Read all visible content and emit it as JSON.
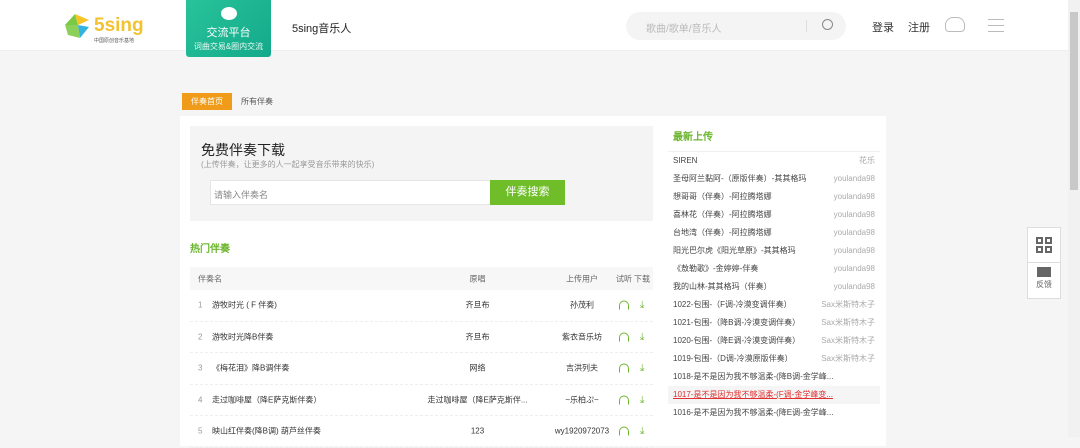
{
  "header": {
    "logo_text": "5sing",
    "logo_sub": "中国原创音乐基地",
    "platform_title": "交流平台",
    "platform_sub": "词曲交易&圈内交流",
    "musician": "5sing音乐人",
    "search_placeholder": "歌曲/歌单/音乐人",
    "login": "登录",
    "register": "注册"
  },
  "tabs": [
    "伴奏首页",
    "所有伴奏"
  ],
  "download": {
    "title": "免费伴奏下载",
    "subtitle": "(上传伴奏，让更多的人一起享受音乐带来的快乐)",
    "input_placeholder": "请输入伴奏名",
    "button": "伴奏搜索"
  },
  "hot": {
    "title": "热门伴奏",
    "headers": {
      "name": "伴奏名",
      "original": "原唱",
      "uploader": "上传用户",
      "listen": "试听",
      "download": "下载"
    },
    "rows": [
      {
        "idx": "1",
        "name": "游牧时光 ( F 伴奏)",
        "original": "齐旦布",
        "uploader": "孙茂利"
      },
      {
        "idx": "2",
        "name": "游牧时光降B伴奏",
        "original": "齐旦布",
        "uploader": "紫衣音乐坊"
      },
      {
        "idx": "3",
        "name": "《梅花泪》降B调伴奏",
        "original": "网络",
        "uploader": "吉洪列夫"
      },
      {
        "idx": "4",
        "name": "走过咖啡屋（降E萨克斯伴奏）",
        "original": "走过咖啡屋（降E萨克斯伴...",
        "uploader": "~乐柏ぷ~"
      },
      {
        "idx": "5",
        "name": "映山红伴奏(降B调) 葫芦丝伴奏",
        "original": "123",
        "uploader": "wy1920972073"
      }
    ]
  },
  "latest": {
    "title": "最新上传",
    "items": [
      {
        "name": "SIREN",
        "user": "花乐"
      },
      {
        "name": "圣母阿兰黏阿-（原版伴奏）-其其格玛",
        "user": "youlanda98"
      },
      {
        "name": "想哥哥（伴奏）-阿拉腾塔娜",
        "user": "youlanda98"
      },
      {
        "name": "喜林花（伴奏）-阿拉腾塔娜",
        "user": "youlanda98"
      },
      {
        "name": "台地湾（伴奏）-阿拉腾塔娜",
        "user": "youlanda98"
      },
      {
        "name": "阳光巴尔虎《阳光草原》-其其格玛",
        "user": "youlanda98"
      },
      {
        "name": "《敖勒歌》-金婷婷-伴奏",
        "user": "youlanda98"
      },
      {
        "name": "我的山林-其其格玛（伴奏）",
        "user": "youlanda98"
      },
      {
        "name": "1022-包围-（F调-冷漠变调伴奏）",
        "user": "Sax米斯特木子"
      },
      {
        "name": "1021-包围-（降B调-冷漠变调伴奏）",
        "user": "Sax米斯特木子"
      },
      {
        "name": "1020-包围-（降E调-冷漠变调伴奏）",
        "user": "Sax米斯特木子"
      },
      {
        "name": "1019-包围-（D调-冷漠原版伴奏）",
        "user": "Sax米斯特木子"
      },
      {
        "name": "1018-是不是因为我不够温柔-(降B调-金学峰...",
        "user": ""
      },
      {
        "name": "1017-是不是因为我不够温柔-(F调-金学峰变...",
        "user": ""
      },
      {
        "name": "1016-是不是因为我不够温柔-(降E调-金学峰...",
        "user": ""
      }
    ]
  },
  "float": {
    "feedback": "反馈"
  }
}
